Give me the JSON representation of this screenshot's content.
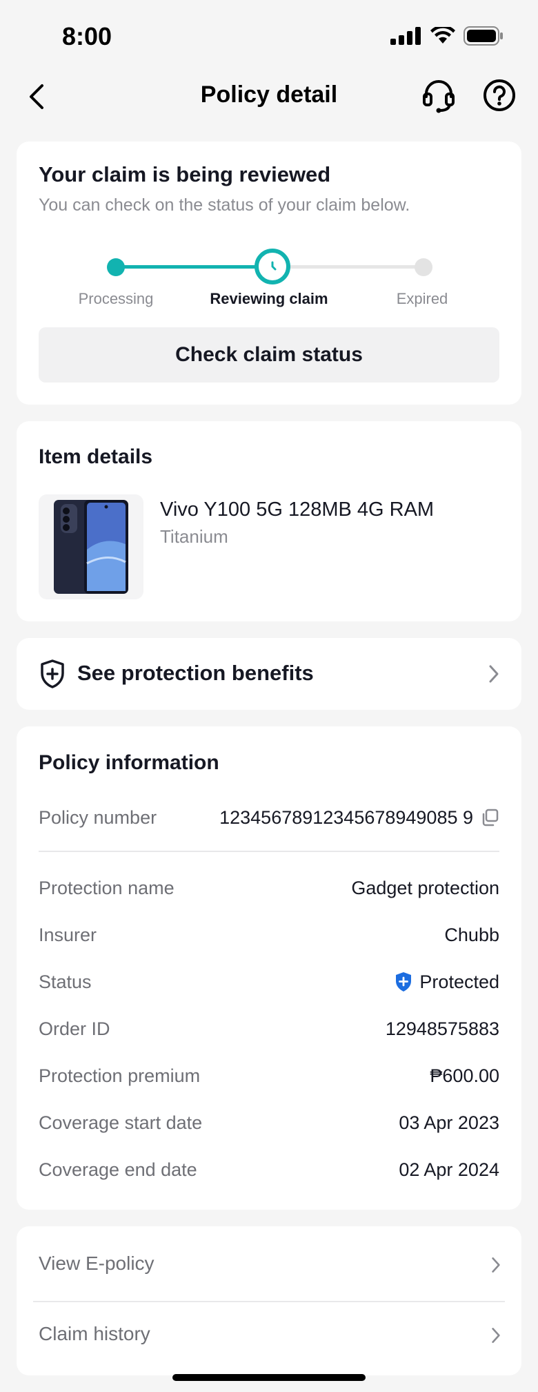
{
  "status_bar": {
    "time": "8:00"
  },
  "nav": {
    "title": "Policy detail"
  },
  "claim": {
    "title": "Your claim is being reviewed",
    "subtitle": "You can check on the status of your claim below.",
    "steps": [
      "Processing",
      "Reviewing claim",
      "Expired"
    ],
    "current_step": 2,
    "button_label": "Check claim status"
  },
  "item": {
    "section_title": "Item details",
    "name": "Vivo Y100 5G 128MB 4G RAM",
    "variant": "Titanium"
  },
  "benefits": {
    "label": "See protection benefits"
  },
  "policy": {
    "section_title": "Policy information",
    "policy_number_label": "Policy number",
    "policy_number": "12345678912345678949085 9",
    "rows": [
      {
        "label": "Protection name",
        "value": "Gadget protection"
      },
      {
        "label": "Insurer",
        "value": "Chubb"
      },
      {
        "label": "Status",
        "value": "Protected"
      },
      {
        "label": "Order ID",
        "value": "12948575883"
      },
      {
        "label": "Protection premium",
        "value": "₱600.00"
      },
      {
        "label": "Coverage start date",
        "value": "03 Apr 2023"
      },
      {
        "label": "Coverage end date",
        "value": "02 Apr 2024"
      }
    ]
  },
  "links": [
    {
      "label": "View E-policy"
    },
    {
      "label": "Claim history"
    }
  ],
  "colors": {
    "accent": "#12b3b0",
    "protected_badge": "#1c6de0"
  }
}
